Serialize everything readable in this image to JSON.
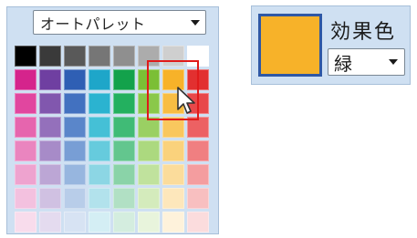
{
  "palette_panel": {
    "select_value": "オートパレット",
    "selected_cell": {
      "row": 1,
      "col": 6
    },
    "colors": [
      [
        "#000000",
        "#3a3a3a",
        "#595959",
        "#767676",
        "#8f8f8f",
        "#acacac",
        "#cfcfcf",
        "#ffffff"
      ],
      [
        "#d5248c",
        "#6f3fa1",
        "#2f5fb4",
        "#1ea6c9",
        "#13a24b",
        "#7bbf35",
        "#f7b229",
        "#e23030"
      ],
      [
        "#e1469f",
        "#8157ae",
        "#4271c0",
        "#2bb3d0",
        "#23b05f",
        "#8ac84a",
        "#f8bd43",
        "#e8484a"
      ],
      [
        "#e665ae",
        "#9470bb",
        "#5a86ca",
        "#45c0d6",
        "#40bb76",
        "#9ad063",
        "#f9c75e",
        "#ec6163"
      ],
      [
        "#ea85bf",
        "#a78bc8",
        "#789ed5",
        "#66cbdd",
        "#63c68e",
        "#acd97f",
        "#fad27c",
        "#f07f81"
      ],
      [
        "#eea3cf",
        "#bca6d5",
        "#97b6df",
        "#8cd6e4",
        "#8ad3a8",
        "#c0e29d",
        "#fbdc9b",
        "#f49d9f"
      ],
      [
        "#f3c1df",
        "#d0c1e2",
        "#b8cde9",
        "#b2e2ec",
        "#b1e0c4",
        "#d4ebbc",
        "#fde7bb",
        "#f8bfc0"
      ],
      [
        "#f8dcec",
        "#e4dbef",
        "#d7e3f3",
        "#d4eef4",
        "#d4eddf",
        "#e8f4dc",
        "#fef2db",
        "#fbdcdd"
      ]
    ]
  },
  "effect_panel": {
    "label": "効果色",
    "select_value": "緑",
    "swatch_color": "#f7b229"
  }
}
